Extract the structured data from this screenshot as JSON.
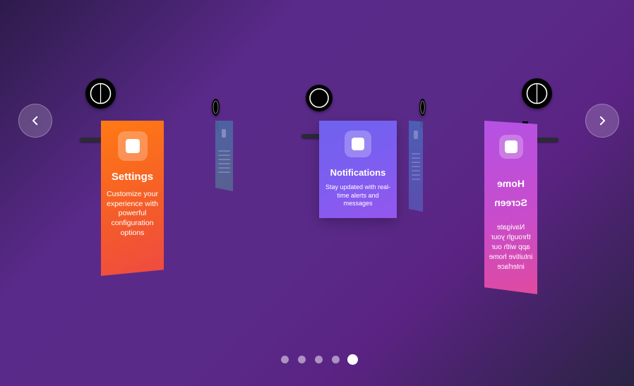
{
  "carousel": {
    "prev_icon": "chevron-left-icon",
    "next_icon": "chevron-right-icon",
    "cards": [
      {
        "title": "Settings",
        "description": "Customize your experience with powerful configuration options",
        "icon": "settings-icon",
        "gradient": [
          "#ff7a14",
          "#ef4a42"
        ]
      },
      {
        "title": "Notifications",
        "description": "Stay updated with real-time alerts and messages",
        "icon": "bell-icon",
        "gradient": [
          "#6e62ee",
          "#9656ee"
        ]
      },
      {
        "title": "Home Screen",
        "description": "Navigate through your app with our intuitive home interface",
        "icon": "home-icon",
        "gradient": [
          "#b552e4",
          "#e04aa0"
        ]
      }
    ],
    "pagination": {
      "total": 5,
      "active_index": 4
    }
  },
  "colors": {
    "background_start": "#2d1b4a",
    "background_mid": "#5a2a8a",
    "background_end": "#2a2343",
    "hang_bar": "#2b2b33",
    "dot_inactive": "rgba(255,255,255,0.5)",
    "dot_active": "#ffffff"
  }
}
